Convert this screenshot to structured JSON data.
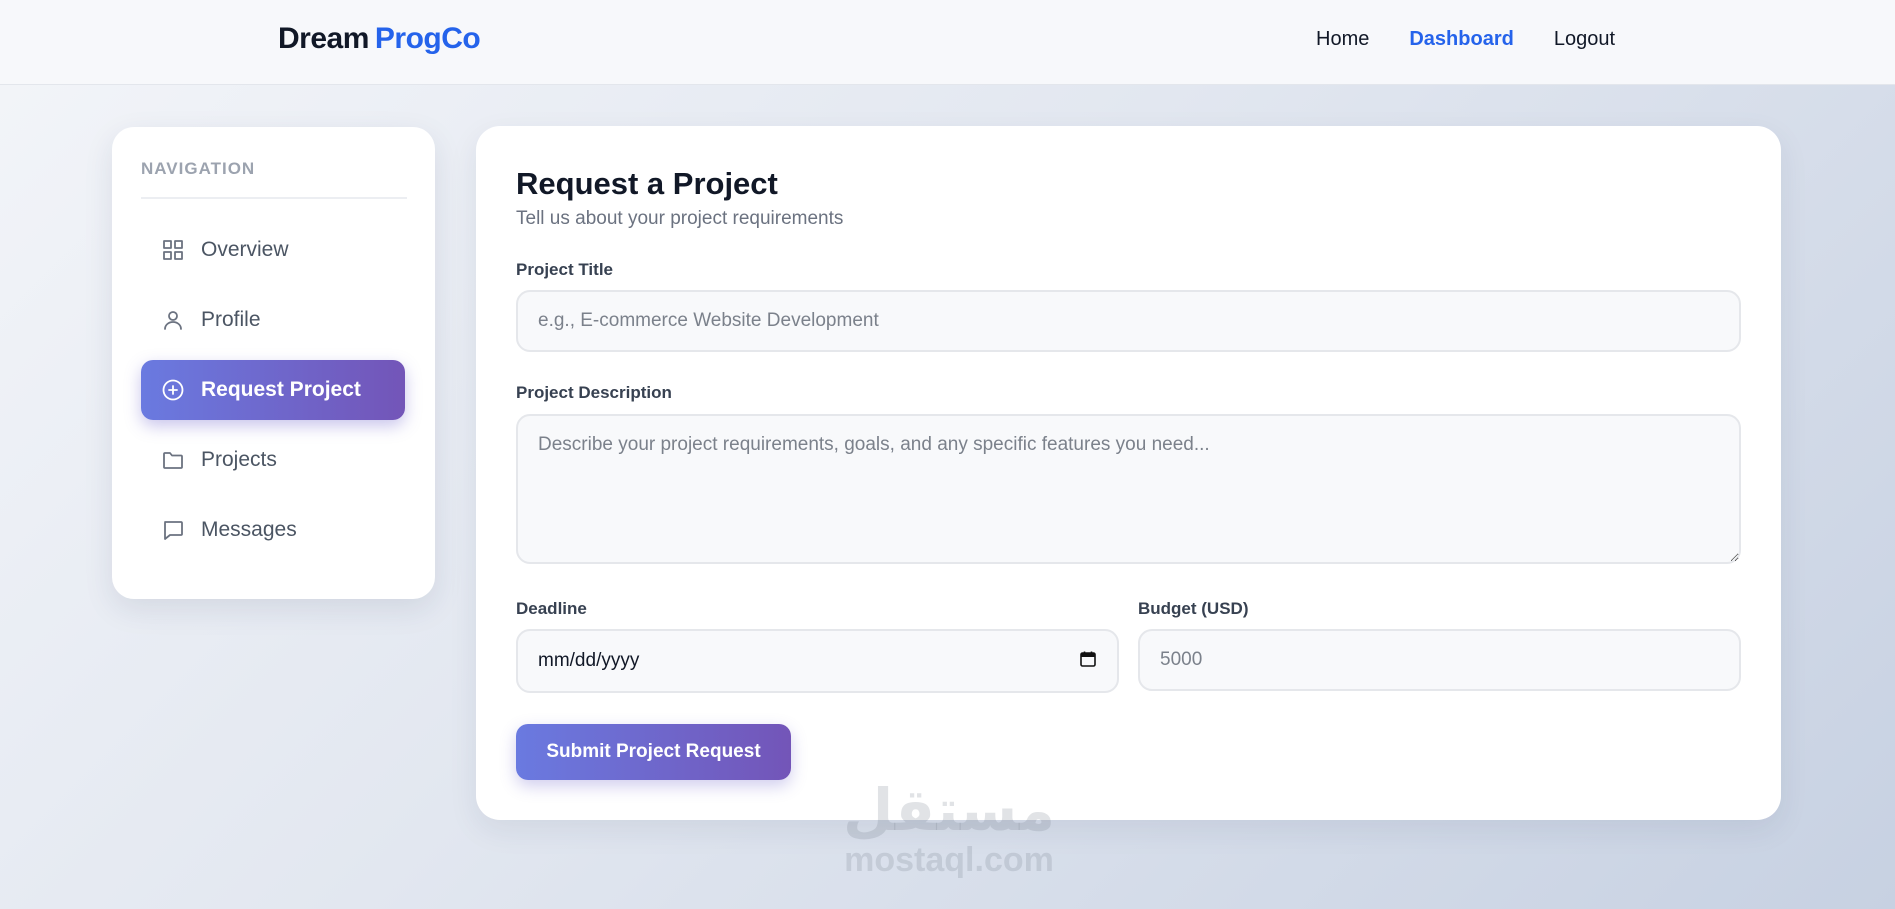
{
  "header": {
    "brand_part1": "Dream",
    "brand_part2": "ProgCo",
    "links": [
      {
        "label": "Home"
      },
      {
        "label": "Dashboard"
      },
      {
        "label": "Logout"
      }
    ]
  },
  "sidebar": {
    "title": "NAVIGATION",
    "items": [
      {
        "label": "Overview",
        "icon": "grid-icon"
      },
      {
        "label": "Profile",
        "icon": "user-icon"
      },
      {
        "label": "Request Project",
        "icon": "plus-circle-icon",
        "active": true
      },
      {
        "label": "Projects",
        "icon": "folder-icon"
      },
      {
        "label": "Messages",
        "icon": "message-icon"
      }
    ]
  },
  "form": {
    "title": "Request a Project",
    "subtitle": "Tell us about your project requirements",
    "project_title_label": "Project Title",
    "project_title_placeholder": "e.g., E-commerce Website Development",
    "description_label": "Project Description",
    "description_placeholder": "Describe your project requirements, goals, and any specific features you need...",
    "deadline_label": "Deadline",
    "deadline_value": "mm/dd/yyyy",
    "budget_label": "Budget (USD)",
    "budget_placeholder": "5000",
    "submit_label": "Submit Project Request"
  },
  "watermark": {
    "arabic": "مستقل",
    "latin": "mostaql.com"
  },
  "colors": {
    "brand_accent": "#2563eb",
    "gradient_start": "#6a7ae0",
    "gradient_end": "#7355b8"
  }
}
